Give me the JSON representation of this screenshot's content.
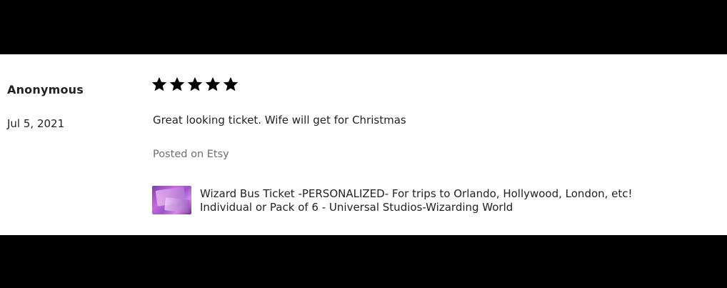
{
  "review": {
    "reviewer": "Anonymous",
    "date": "Jul 5, 2021",
    "rating": 5,
    "rating_max": 5,
    "text": "Great looking ticket. Wife will get for Christmas",
    "source": "Posted on Etsy"
  },
  "product": {
    "title_line1": "Wizard Bus Ticket -PERSONALIZED- For trips to Orlando, Hollywood, London, etc!",
    "title_line2": "Individual or Pack of 6 - Universal Studios-Wizarding World",
    "thumbnail_icon": "product-thumbnail-image"
  },
  "colors": {
    "text": "#222222",
    "muted": "#6e6e6e",
    "star": "#000000",
    "letterbox": "#000000",
    "panel": "#ffffff"
  },
  "icons": {
    "star": "star-icon"
  }
}
